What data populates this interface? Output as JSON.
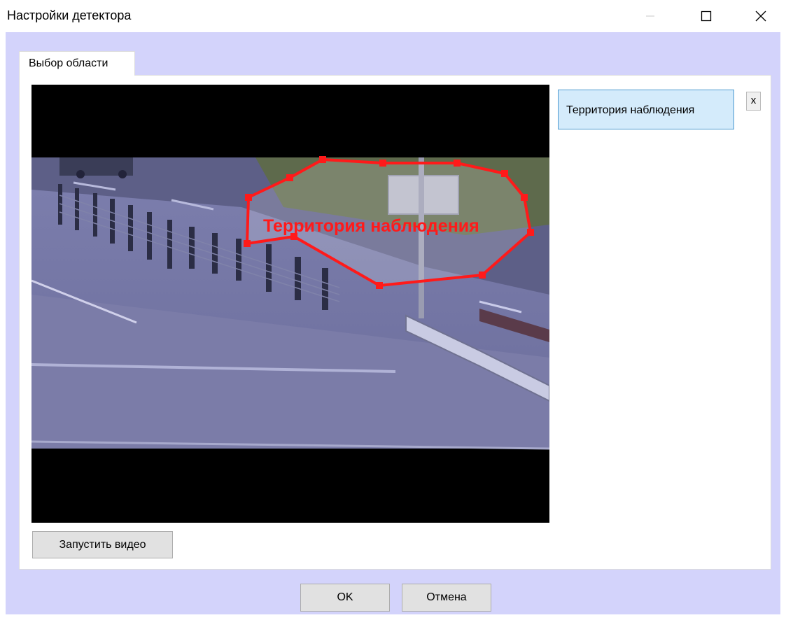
{
  "window": {
    "title": "Настройки детектора",
    "minimize_icon": "minimize-icon",
    "maximize_icon": "maximize-icon",
    "close_icon": "close-icon"
  },
  "tabs": [
    {
      "label": "Выбор области",
      "selected": true
    }
  ],
  "video": {
    "zone_label": "Территория наблюдения",
    "zone_color": "#ff1a1a"
  },
  "regions": {
    "items": [
      {
        "label": "Территория наблюдения",
        "selected": true
      }
    ],
    "delete_label": "x"
  },
  "buttons": {
    "run_video": "Запустить видео",
    "ok": "OK",
    "cancel": "Отмена"
  },
  "colors": {
    "client_background": "#d3d3fb",
    "selected_item": "#d4ebfb",
    "selected_border": "#4e9ad0"
  }
}
